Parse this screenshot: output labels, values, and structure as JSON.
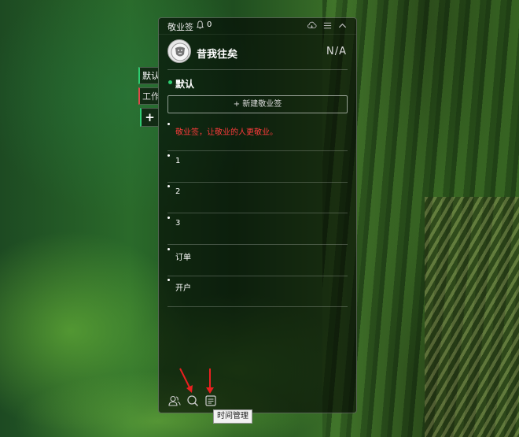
{
  "app": {
    "title": "敬业签",
    "notification_count": "0"
  },
  "side_tabs": [
    {
      "label": "默认"
    },
    {
      "label": "工作"
    },
    {
      "label": "+"
    }
  ],
  "user": {
    "name": "昔我往矣",
    "status": "N/A"
  },
  "group": {
    "name": "默认",
    "new_note_label": "+ 新建敬业签"
  },
  "notes": [
    {
      "text": "敬业签，让敬业的人更敬业。"
    },
    {
      "text": "1"
    },
    {
      "text": "2"
    },
    {
      "text": "3"
    },
    {
      "text": "订单"
    },
    {
      "text": "开户"
    }
  ],
  "tooltip": "时间管理",
  "colors": {
    "accent": "#2ecc71",
    "highlight_note": "#ff3b3b",
    "annotation_arrow": "#e82020"
  },
  "icons": {
    "titlebar": [
      "bell-icon",
      "cloud-icon",
      "menu-icon",
      "collapse-icon"
    ],
    "bottom": [
      "contacts-icon",
      "search-icon",
      "time-management-icon"
    ]
  }
}
